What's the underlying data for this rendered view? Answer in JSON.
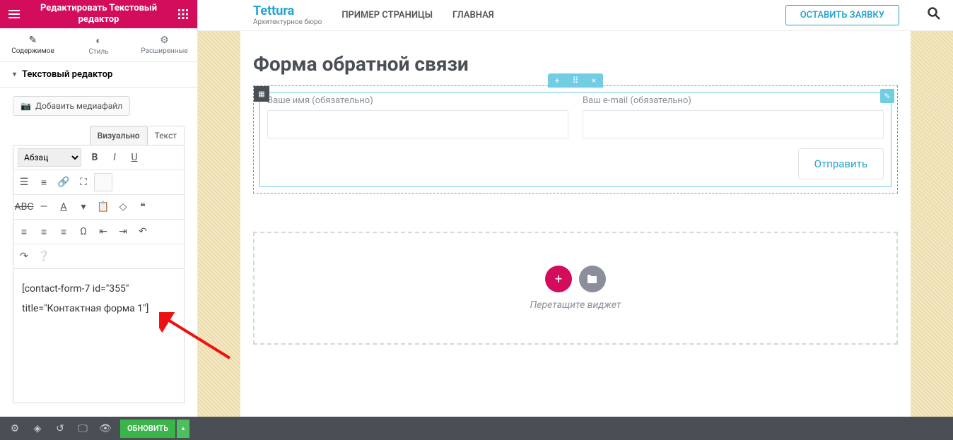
{
  "sidebar": {
    "header_line1": "Редактировать Текстовый",
    "header_line2": "редактор",
    "tabs": {
      "content": "Содержимое",
      "style": "Стиль",
      "advanced": "Расширенные"
    },
    "section_title": "Текстовый редактор",
    "media_btn": "Добавить медиафайл",
    "wys_visual": "Визуально",
    "wys_text": "Текст",
    "format": "Абзац",
    "editor_line1": "[contact-form-7 id=\"355\"",
    "editor_line2": "title=\"Контактная форма 1\"]"
  },
  "header": {
    "logo": "Tettura",
    "tagline": "Архитектурное бюро",
    "nav1": "ПРИМЕР СТРАНИЦЫ",
    "nav2": "ГЛАВНАЯ",
    "cta": "ОСТАВИТЬ ЗАЯВКУ"
  },
  "page": {
    "title": "Форма обратной связи",
    "name_label": "Ваше имя (обязательно)",
    "email_label": "Ваш e-mail (обязательно)",
    "submit": "Отправить",
    "drop_text": "Перетащите виджет"
  },
  "footer": {
    "update": "ОБНОВИТЬ"
  }
}
